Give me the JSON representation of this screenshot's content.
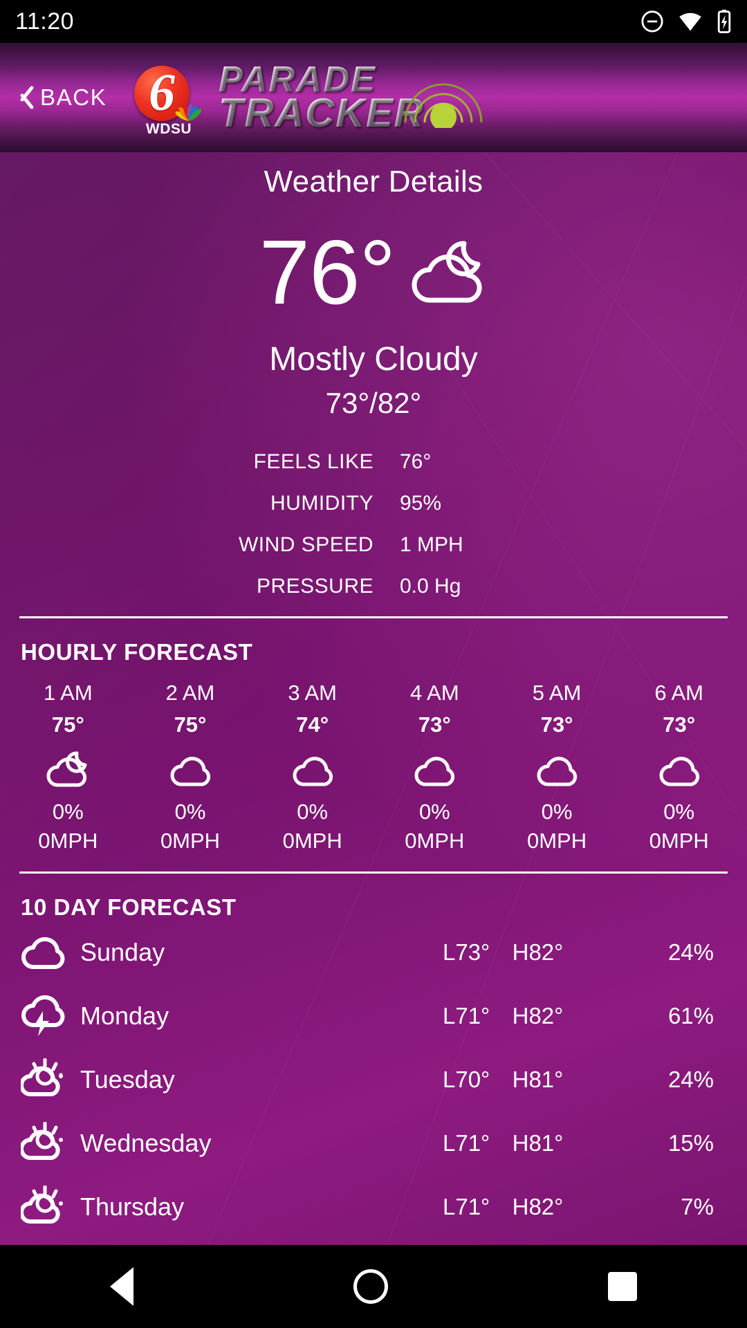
{
  "status_bar": {
    "time": "11:20",
    "icons": [
      "do-not-disturb-icon",
      "wifi-icon",
      "battery-icon"
    ]
  },
  "app_bar": {
    "back_label": "BACK",
    "back_icon": "chevron-left-icon",
    "station": "WDSU",
    "station_number": "6",
    "logo_line1": "PARADE",
    "logo_line2": "TRACKER"
  },
  "page": {
    "title": "Weather Details"
  },
  "current": {
    "temperature": "76°",
    "icon": "moon-cloud-icon",
    "condition": "Mostly Cloudy",
    "high_low": "73°/82°",
    "stats": [
      {
        "label": "FEELS LIKE",
        "value": "76°"
      },
      {
        "label": "HUMIDITY",
        "value": "95%"
      },
      {
        "label": "WIND SPEED",
        "value": "1 MPH"
      },
      {
        "label": "PRESSURE",
        "value": "0.0 Hg"
      }
    ]
  },
  "hourly": {
    "title": "HOURLY FORECAST",
    "items": [
      {
        "time": "1 AM",
        "temp": "75°",
        "icon": "moon-cloud-icon",
        "pop": "0%",
        "wind": "0MPH"
      },
      {
        "time": "2 AM",
        "temp": "75°",
        "icon": "cloud-icon",
        "pop": "0%",
        "wind": "0MPH"
      },
      {
        "time": "3 AM",
        "temp": "74°",
        "icon": "cloud-icon",
        "pop": "0%",
        "wind": "0MPH"
      },
      {
        "time": "4 AM",
        "temp": "73°",
        "icon": "cloud-icon",
        "pop": "0%",
        "wind": "0MPH"
      },
      {
        "time": "5 AM",
        "temp": "73°",
        "icon": "cloud-icon",
        "pop": "0%",
        "wind": "0MPH"
      },
      {
        "time": "6 AM",
        "temp": "73°",
        "icon": "cloud-icon",
        "pop": "0%",
        "wind": "0MPH"
      }
    ]
  },
  "daily": {
    "title": "10 DAY FORECAST",
    "items": [
      {
        "day": "Sunday",
        "icon": "cloud-icon",
        "low": "L73°",
        "high": "H82°",
        "pop": "24%"
      },
      {
        "day": "Monday",
        "icon": "thunderstorm-icon",
        "low": "L71°",
        "high": "H82°",
        "pop": "61%"
      },
      {
        "day": "Tuesday",
        "icon": "sun-cloud-icon",
        "low": "L70°",
        "high": "H81°",
        "pop": "24%"
      },
      {
        "day": "Wednesday",
        "icon": "sun-cloud-icon",
        "low": "L71°",
        "high": "H81°",
        "pop": "15%"
      },
      {
        "day": "Thursday",
        "icon": "sun-cloud-icon",
        "low": "L71°",
        "high": "H82°",
        "pop": "7%"
      }
    ]
  },
  "nav_bar": {
    "back": "nav-back-icon",
    "home": "nav-home-icon",
    "recents": "nav-recents-icon"
  },
  "colors": {
    "background_purple": "#7d1573",
    "header_magenta": "#b32ea8",
    "text": "#ffffff"
  }
}
